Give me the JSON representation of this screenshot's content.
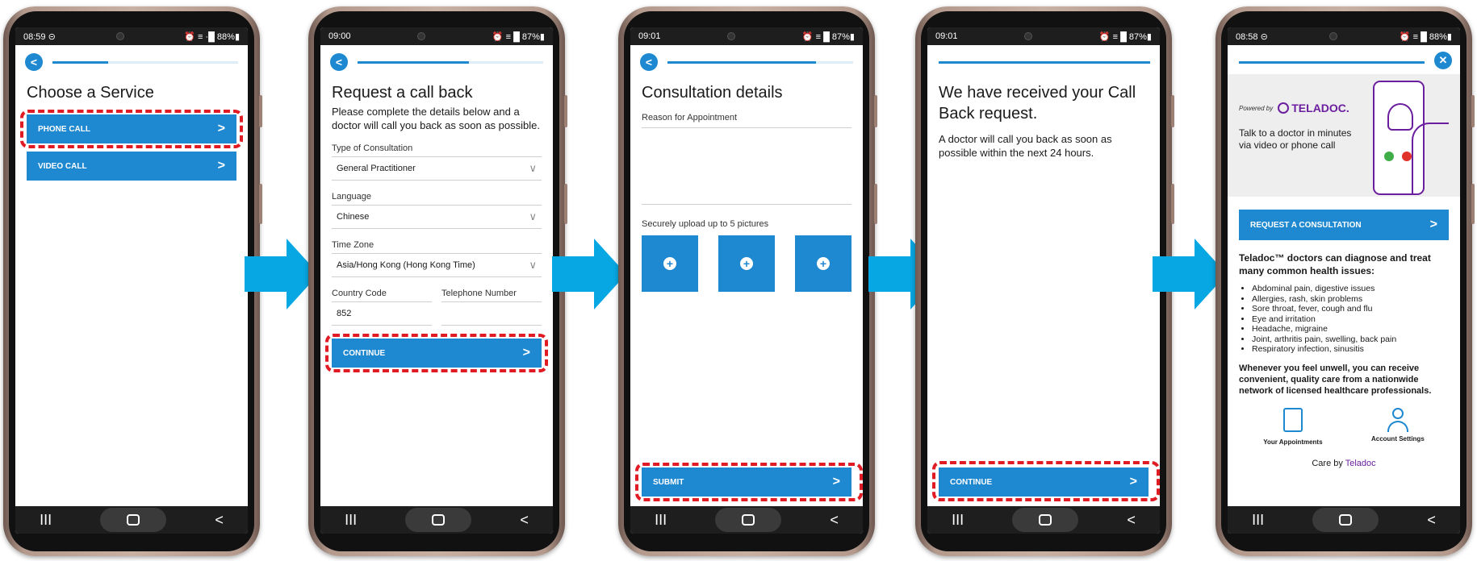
{
  "colors": {
    "accent": "#1e88d0",
    "arrow": "#06a7e2",
    "highlight": "#e01b24",
    "teladoc": "#6b1f9e"
  },
  "phones": [
    {
      "status_time": "08:59 ⊝",
      "status_right": "⏰ ≡ ·█ 88%▮",
      "progress": 0.3
    },
    {
      "status_time": "09:00",
      "status_right": "⏰ ≡ █ 87%▮",
      "progress": 0.6
    },
    {
      "status_time": "09:01",
      "status_right": "⏰ ≡ █ 87%▮",
      "progress": 0.8
    },
    {
      "status_time": "09:01",
      "status_right": "⏰ ≡ █ 87%▮",
      "progress": 1.0
    },
    {
      "status_time": "08:58 ⊝",
      "status_right": "⏰ ≡ █ 88%▮",
      "progress": 1.0
    }
  ],
  "nav": {
    "recent": "III",
    "back": "<"
  },
  "screen1": {
    "title": "Choose a Service",
    "phone_call": "PHONE CALL",
    "video_call": "VIDEO CALL"
  },
  "screen2": {
    "title": "Request a call back",
    "intro": "Please complete the details below and a doctor will call you back as soon as possible.",
    "consult_label": "Type of Consultation",
    "consult_value": "General Practitioner",
    "language_label": "Language",
    "language_value": "Chinese",
    "timezone_label": "Time Zone",
    "timezone_value": "Asia/Hong  Kong (Hong Kong Time)",
    "country_label": "Country Code",
    "country_value": "852",
    "phone_label": "Telephone Number",
    "phone_value": "",
    "continue": "CONTINUE"
  },
  "screen3": {
    "title": "Consultation details",
    "reason_label": "Reason for Appointment",
    "reason_value": "",
    "upload_label": "Securely upload up to 5 pictures",
    "submit": "SUBMIT"
  },
  "screen4": {
    "title": "We have received your Call Back request.",
    "message": "A doctor will call you back as soon as possible within the next 24 hours.",
    "continue": "CONTINUE"
  },
  "screen5": {
    "powered_by": "Powered by",
    "brand": "TELADOC.",
    "tagline": "Talk to a doctor in minutes via video or phone call",
    "request": "REQUEST A CONSULTATION",
    "headline": "Teladoc™ doctors can diagnose and treat many common health issues:",
    "conditions": [
      "Abdominal pain, digestive issues",
      "Allergies, rash, skin problems",
      "Sore throat, fever, cough and flu",
      "Eye and irritation",
      "Headache, migraine",
      "Joint, arthritis pain, swelling, back pain",
      "Respiratory infection, sinusitis"
    ],
    "closing": "Whenever you feel unwell, you can receive convenient, quality care from a nationwide network of licensed healthcare professionals.",
    "appointments": "Your Appointments",
    "settings": "Account Settings",
    "care_by": "Care by",
    "care_brand": "Teladoc"
  }
}
